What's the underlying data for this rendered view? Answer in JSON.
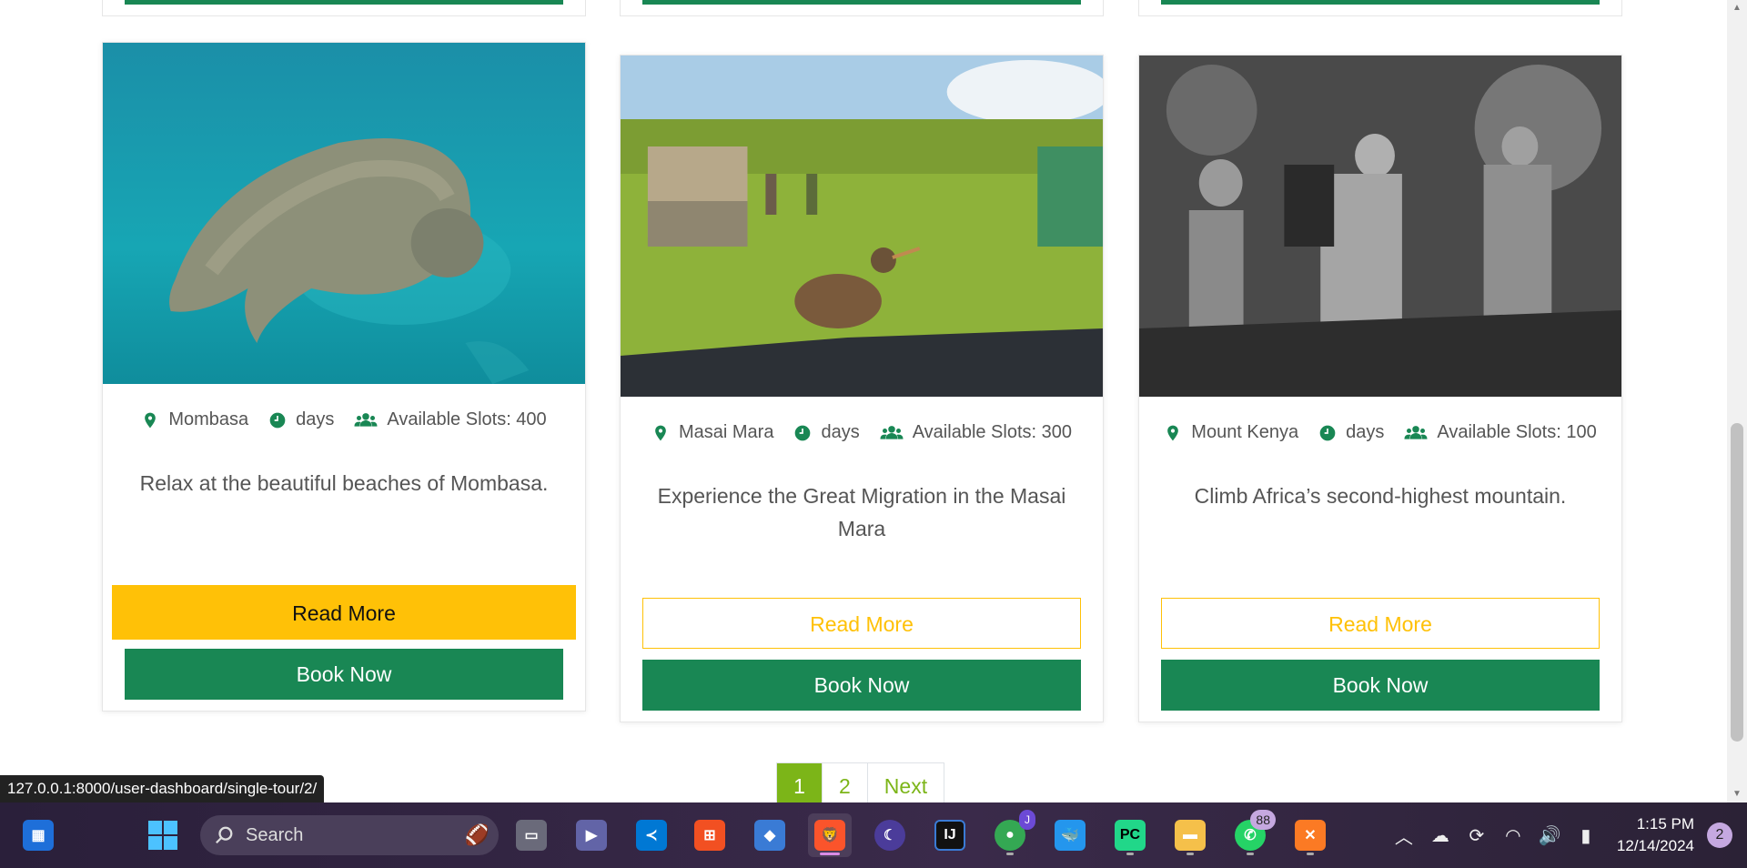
{
  "cards": [
    {
      "location": "Mombasa",
      "duration": "days",
      "slots": "Available Slots: 400",
      "description": "Relax at the beautiful beaches of Mombasa.",
      "read_more": "Read More",
      "book_now": "Book Now"
    },
    {
      "location": "Masai Mara",
      "duration": "days",
      "slots": "Available Slots: 300",
      "description": "Experience the Great Migration in the Masai Mara",
      "read_more": "Read More",
      "book_now": "Book Now"
    },
    {
      "location": "Mount Kenya",
      "duration": "days",
      "slots": "Available Slots: 100",
      "description": "Climb Africa’s second-highest mountain.",
      "read_more": "Read More",
      "book_now": "Book Now"
    }
  ],
  "pagination": {
    "page1": "1",
    "page2": "2",
    "next": "Next"
  },
  "status_url": "127.0.0.1:8000/user-dashboard/single-tour/2/",
  "taskbar": {
    "search_placeholder": "Search",
    "whatsapp_badge": "88",
    "chrome_badge": "J",
    "time": "1:15 PM",
    "date": "12/14/2024",
    "notification_count": "2"
  },
  "colors": {
    "primary_green": "#198754",
    "warning_yellow": "#ffc107",
    "pager_green": "#7cb518"
  }
}
